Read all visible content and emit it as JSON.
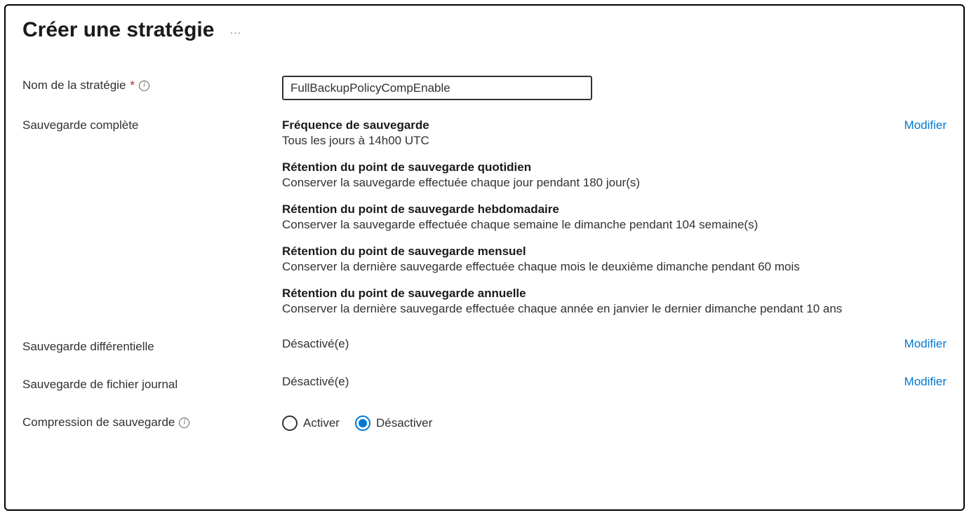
{
  "page_title": "Créer une stratégie",
  "fields": {
    "policy_name": {
      "label": "Nom de la stratégie",
      "value": "FullBackupPolicyCompEnable"
    },
    "full_backup": {
      "label": "Sauvegarde complète",
      "edit_link": "Modifier",
      "sections": {
        "frequency": {
          "title": "Fréquence de sauvegarde",
          "desc": "Tous les jours à 14h00 UTC"
        },
        "daily_retention": {
          "title": "Rétention du point de sauvegarde quotidien",
          "desc": "Conserver la sauvegarde effectuée chaque jour pendant 180 jour(s)"
        },
        "weekly_retention": {
          "title": "Rétention du point de sauvegarde hebdomadaire",
          "desc": "Conserver la sauvegarde effectuée chaque semaine le dimanche pendant 104 semaine(s)"
        },
        "monthly_retention": {
          "title": "Rétention du point de sauvegarde mensuel",
          "desc": "Conserver la dernière sauvegarde effectuée chaque mois le deuxième dimanche pendant 60 mois"
        },
        "yearly_retention": {
          "title": "Rétention du point de sauvegarde annuelle",
          "desc": "Conserver la dernière sauvegarde effectuée chaque année en janvier le dernier dimanche pendant 10 ans"
        }
      }
    },
    "differential_backup": {
      "label": "Sauvegarde différentielle",
      "value": "Désactivé(e)",
      "edit_link": "Modifier"
    },
    "log_backup": {
      "label": "Sauvegarde de fichier journal",
      "value": "Désactivé(e)",
      "edit_link": "Modifier"
    },
    "compression": {
      "label": "Compression de sauvegarde",
      "options": {
        "enable": "Activer",
        "disable": "Désactiver"
      },
      "selected": "disable"
    }
  }
}
